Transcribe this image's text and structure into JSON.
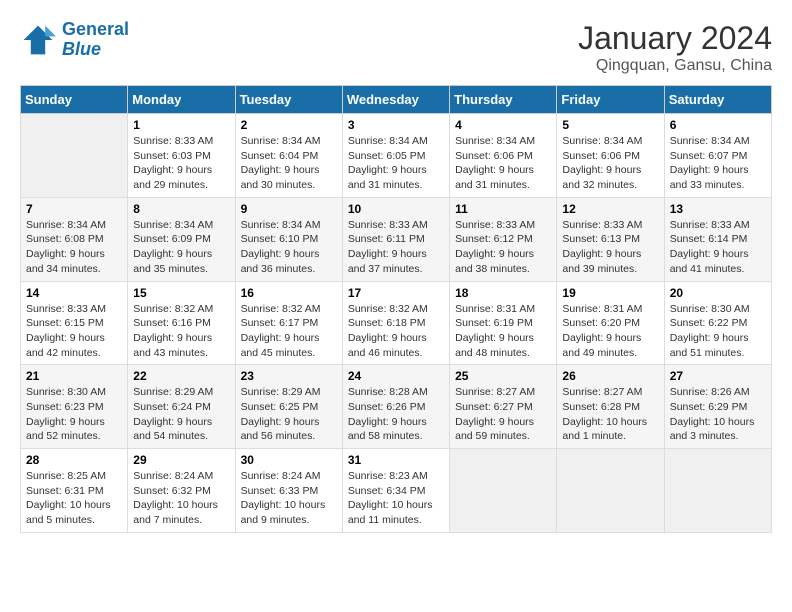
{
  "header": {
    "logo_line1": "General",
    "logo_line2": "Blue",
    "title": "January 2024",
    "subtitle": "Qingquan, Gansu, China"
  },
  "weekdays": [
    "Sunday",
    "Monday",
    "Tuesday",
    "Wednesday",
    "Thursday",
    "Friday",
    "Saturday"
  ],
  "weeks": [
    [
      {
        "day": "",
        "info": ""
      },
      {
        "day": "1",
        "info": "Sunrise: 8:33 AM\nSunset: 6:03 PM\nDaylight: 9 hours\nand 29 minutes."
      },
      {
        "day": "2",
        "info": "Sunrise: 8:34 AM\nSunset: 6:04 PM\nDaylight: 9 hours\nand 30 minutes."
      },
      {
        "day": "3",
        "info": "Sunrise: 8:34 AM\nSunset: 6:05 PM\nDaylight: 9 hours\nand 31 minutes."
      },
      {
        "day": "4",
        "info": "Sunrise: 8:34 AM\nSunset: 6:06 PM\nDaylight: 9 hours\nand 31 minutes."
      },
      {
        "day": "5",
        "info": "Sunrise: 8:34 AM\nSunset: 6:06 PM\nDaylight: 9 hours\nand 32 minutes."
      },
      {
        "day": "6",
        "info": "Sunrise: 8:34 AM\nSunset: 6:07 PM\nDaylight: 9 hours\nand 33 minutes."
      }
    ],
    [
      {
        "day": "7",
        "info": "Sunrise: 8:34 AM\nSunset: 6:08 PM\nDaylight: 9 hours\nand 34 minutes."
      },
      {
        "day": "8",
        "info": "Sunrise: 8:34 AM\nSunset: 6:09 PM\nDaylight: 9 hours\nand 35 minutes."
      },
      {
        "day": "9",
        "info": "Sunrise: 8:34 AM\nSunset: 6:10 PM\nDaylight: 9 hours\nand 36 minutes."
      },
      {
        "day": "10",
        "info": "Sunrise: 8:33 AM\nSunset: 6:11 PM\nDaylight: 9 hours\nand 37 minutes."
      },
      {
        "day": "11",
        "info": "Sunrise: 8:33 AM\nSunset: 6:12 PM\nDaylight: 9 hours\nand 38 minutes."
      },
      {
        "day": "12",
        "info": "Sunrise: 8:33 AM\nSunset: 6:13 PM\nDaylight: 9 hours\nand 39 minutes."
      },
      {
        "day": "13",
        "info": "Sunrise: 8:33 AM\nSunset: 6:14 PM\nDaylight: 9 hours\nand 41 minutes."
      }
    ],
    [
      {
        "day": "14",
        "info": "Sunrise: 8:33 AM\nSunset: 6:15 PM\nDaylight: 9 hours\nand 42 minutes."
      },
      {
        "day": "15",
        "info": "Sunrise: 8:32 AM\nSunset: 6:16 PM\nDaylight: 9 hours\nand 43 minutes."
      },
      {
        "day": "16",
        "info": "Sunrise: 8:32 AM\nSunset: 6:17 PM\nDaylight: 9 hours\nand 45 minutes."
      },
      {
        "day": "17",
        "info": "Sunrise: 8:32 AM\nSunset: 6:18 PM\nDaylight: 9 hours\nand 46 minutes."
      },
      {
        "day": "18",
        "info": "Sunrise: 8:31 AM\nSunset: 6:19 PM\nDaylight: 9 hours\nand 48 minutes."
      },
      {
        "day": "19",
        "info": "Sunrise: 8:31 AM\nSunset: 6:20 PM\nDaylight: 9 hours\nand 49 minutes."
      },
      {
        "day": "20",
        "info": "Sunrise: 8:30 AM\nSunset: 6:22 PM\nDaylight: 9 hours\nand 51 minutes."
      }
    ],
    [
      {
        "day": "21",
        "info": "Sunrise: 8:30 AM\nSunset: 6:23 PM\nDaylight: 9 hours\nand 52 minutes."
      },
      {
        "day": "22",
        "info": "Sunrise: 8:29 AM\nSunset: 6:24 PM\nDaylight: 9 hours\nand 54 minutes."
      },
      {
        "day": "23",
        "info": "Sunrise: 8:29 AM\nSunset: 6:25 PM\nDaylight: 9 hours\nand 56 minutes."
      },
      {
        "day": "24",
        "info": "Sunrise: 8:28 AM\nSunset: 6:26 PM\nDaylight: 9 hours\nand 58 minutes."
      },
      {
        "day": "25",
        "info": "Sunrise: 8:27 AM\nSunset: 6:27 PM\nDaylight: 9 hours\nand 59 minutes."
      },
      {
        "day": "26",
        "info": "Sunrise: 8:27 AM\nSunset: 6:28 PM\nDaylight: 10 hours\nand 1 minute."
      },
      {
        "day": "27",
        "info": "Sunrise: 8:26 AM\nSunset: 6:29 PM\nDaylight: 10 hours\nand 3 minutes."
      }
    ],
    [
      {
        "day": "28",
        "info": "Sunrise: 8:25 AM\nSunset: 6:31 PM\nDaylight: 10 hours\nand 5 minutes."
      },
      {
        "day": "29",
        "info": "Sunrise: 8:24 AM\nSunset: 6:32 PM\nDaylight: 10 hours\nand 7 minutes."
      },
      {
        "day": "30",
        "info": "Sunrise: 8:24 AM\nSunset: 6:33 PM\nDaylight: 10 hours\nand 9 minutes."
      },
      {
        "day": "31",
        "info": "Sunrise: 8:23 AM\nSunset: 6:34 PM\nDaylight: 10 hours\nand 11 minutes."
      },
      {
        "day": "",
        "info": ""
      },
      {
        "day": "",
        "info": ""
      },
      {
        "day": "",
        "info": ""
      }
    ]
  ]
}
